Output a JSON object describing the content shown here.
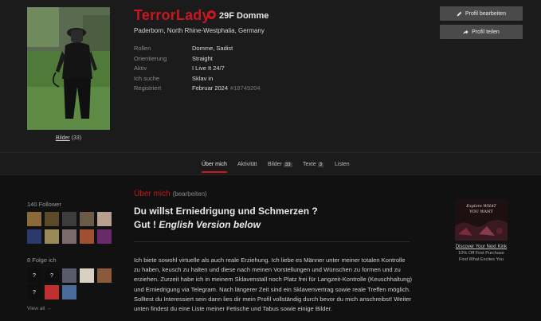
{
  "profile": {
    "username": "TerrorLady",
    "age_sex_role": "29F Domme",
    "location": "Paderborn, North Rhine-Westphalia, Germany",
    "photos_link": "Bilder",
    "photos_count": "(33)",
    "details": [
      {
        "label": "Rollen",
        "value": "Domme, Sadist"
      },
      {
        "label": "Orientierung",
        "value": "Straight"
      },
      {
        "label": "Aktiv",
        "value": "I Live It 24/7"
      },
      {
        "label": "Ich suche",
        "value": "Sklav in"
      },
      {
        "label": "Registriert",
        "value": "Februar 2024",
        "id": "#18749204"
      }
    ]
  },
  "buttons": {
    "edit_profile": "Profil bearbeiten",
    "share_profile": "Profil teilen"
  },
  "tabs": [
    {
      "label": "Über mich"
    },
    {
      "label": "Aktivität"
    },
    {
      "label": "Bilder",
      "count": "33"
    },
    {
      "label": "Texte",
      "count": "3"
    },
    {
      "label": "Listen"
    }
  ],
  "sidebar": {
    "followers_title": "140 Follower",
    "following_title": "8 Folge ich",
    "view_all": "View all →",
    "placeholder_mark": "?"
  },
  "about": {
    "title": "Über mich",
    "edit": "(bearbeiten)",
    "headline1": "Du willst Erniedrigung und Schmerzen ?",
    "headline2_prefix": "Gut ! ",
    "headline2_italic": "English Version below",
    "body": "Ich biete sowohl virtuelle als auch reale Erziehung. Ich liebe es Männer unter meiner totalen Kontrolle zu haben, keusch zu halten und diese nach meinen Vorstellungen und Wünschen zu formen und zu erziehen. Zurzeit habe ich in meinem Sklavenstall noch Platz frei für Langzeit-Kontrolle (Keuschhaltung) und Erniedrigung via Telegram. Nach längerer Zeit sind ein Sklavenvertrag sowie reale Treffen möglich. Solltest du Interessiert sein dann lies dir mein Profil vollständig durch bevor du mich anschreibst! Weiter unten findest du eine Liste meiner Fetische und Tabus sowie einige Bilder."
  },
  "ad": {
    "image_text_line1": "Explore WHAT",
    "image_text_line2": "YOU WANT",
    "line1": "Discover Your Next Kink",
    "line2": "10% Off First Purchase",
    "line3": "Find What Excites You"
  },
  "colors": {
    "accent_red": "#c8171f",
    "button_gray": "#4a4a4a",
    "background": "#111111",
    "header_bg": "#1b1b1b"
  }
}
